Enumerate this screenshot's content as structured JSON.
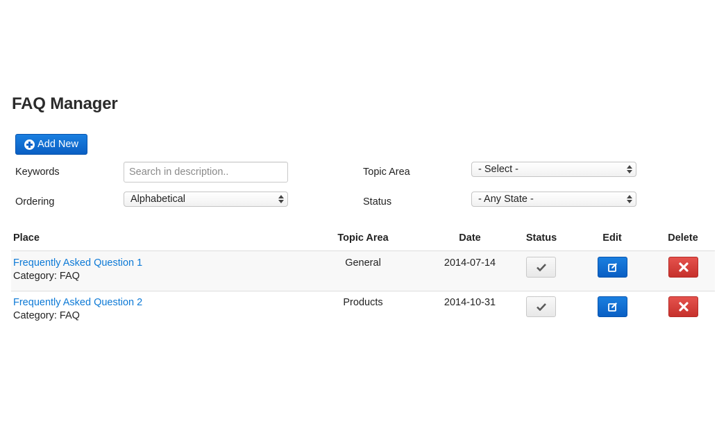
{
  "page": {
    "title": "FAQ Manager"
  },
  "toolbar": {
    "add_label": "Add New",
    "add_icon": "plus-circle-icon"
  },
  "filters": {
    "keywords": {
      "label": "Keywords",
      "placeholder": "Search in description.."
    },
    "ordering": {
      "label": "Ordering",
      "value": "Alphabetical"
    },
    "topic_area": {
      "label": "Topic Area",
      "value": "- Select -"
    },
    "status": {
      "label": "Status",
      "value": "- Any State -"
    }
  },
  "table": {
    "columns": {
      "place": "Place",
      "topic_area": "Topic Area",
      "date": "Date",
      "status": "Status",
      "edit": "Edit",
      "delete": "Delete"
    },
    "rows": [
      {
        "title": "Frequently Asked Question 1",
        "category": "Category: FAQ",
        "topic_area": "General",
        "date": "2014-07-14"
      },
      {
        "title": "Frequently Asked Question 2",
        "category": "Category: FAQ",
        "topic_area": "Products",
        "date": "2014-10-31"
      }
    ]
  },
  "colors": {
    "primary": "#0a62c9",
    "link": "#0c79d6",
    "danger": "#c9302c",
    "row_shade": "#f8f8f8"
  }
}
